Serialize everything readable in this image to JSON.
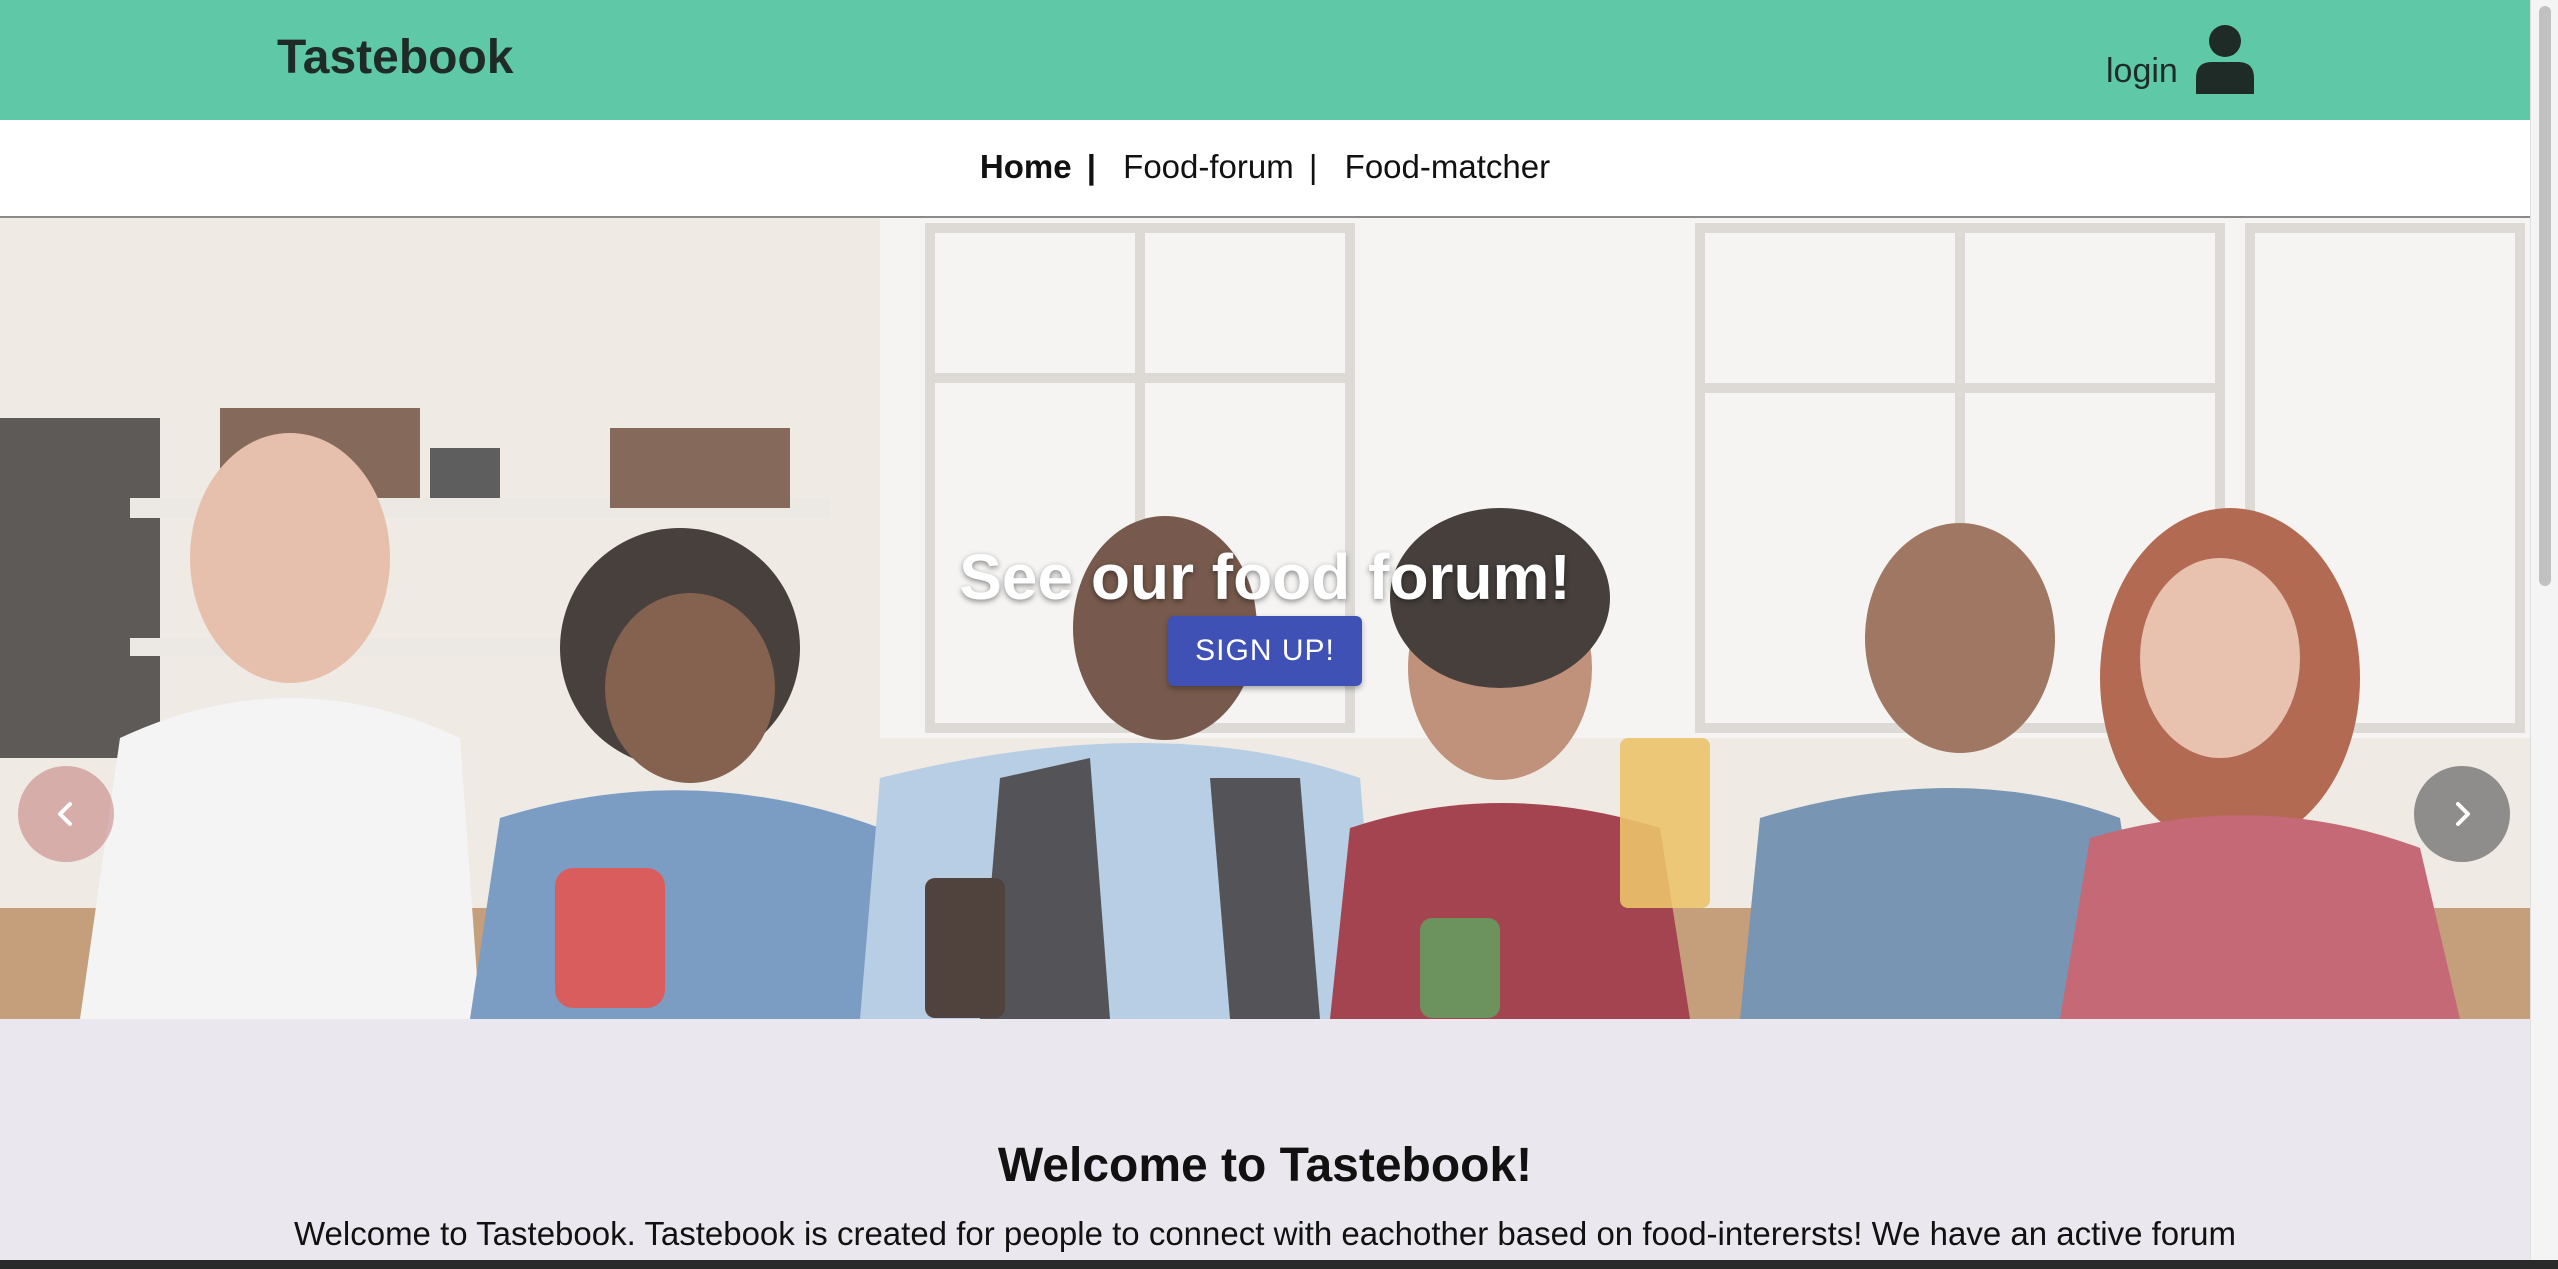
{
  "header": {
    "brand": "Tastebook",
    "login_label": "login",
    "background": "#5ec8a7"
  },
  "nav": {
    "items": [
      {
        "label": "Home",
        "active": true
      },
      {
        "label": "Food-forum",
        "active": false
      },
      {
        "label": "Food-matcher",
        "active": false
      }
    ],
    "separator": "|"
  },
  "hero": {
    "title": "See our food forum!",
    "button_label": "SIGN UP!",
    "button_color": "#3f51b5",
    "prev_icon": "chevron-left-icon",
    "next_icon": "chevron-right-icon"
  },
  "welcome": {
    "title": "Welcome to Tastebook!",
    "text": "Welcome to Tastebook. Tastebook is created for people to connect with eachother based on food-interersts! We have an active forum"
  },
  "icons": {
    "user": "user-icon"
  }
}
